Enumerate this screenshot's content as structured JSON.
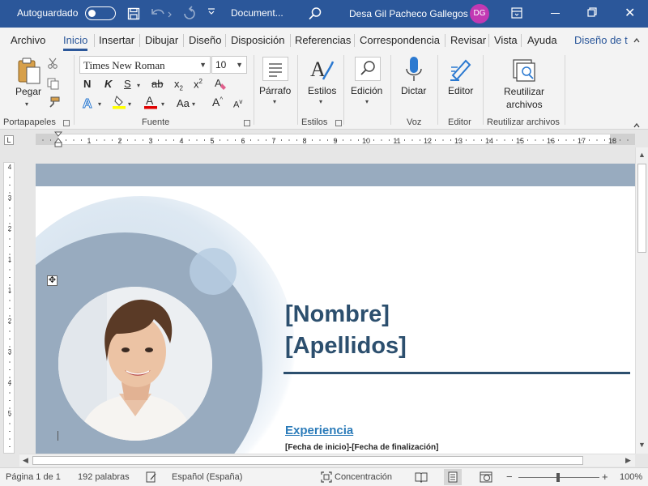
{
  "title_bar": {
    "autosave_label": "Autoguardado",
    "document_name": "Document...",
    "user_name": "Desa Gil Pacheco Gallegos",
    "user_initials": "DG"
  },
  "tabs": [
    "Archivo",
    "Inicio",
    "Insertar",
    "Dibujar",
    "Diseño",
    "Disposición",
    "Referencias",
    "Correspondencia",
    "Revisar",
    "Vista",
    "Ayuda",
    "Diseño de t"
  ],
  "active_tab": "Inicio",
  "ribbon": {
    "clipboard": {
      "paste_label": "Pegar",
      "group_label": "Portapapeles"
    },
    "font": {
      "font_name": "Times New Roman",
      "font_size": "10",
      "bold": "N",
      "italic": "K",
      "underline": "S",
      "strike": "ab",
      "subscript": "x",
      "superscript": "x",
      "change_case": "Aa",
      "grow": "A",
      "shrink": "A",
      "group_label": "Fuente"
    },
    "paragraph": {
      "label": "Párrafo"
    },
    "styles": {
      "label": "Estilos",
      "group_label": "Estilos"
    },
    "editing": {
      "label": "Edición"
    },
    "dictate": {
      "label": "Dictar",
      "group_label": "Voz"
    },
    "editor": {
      "label": "Editor",
      "group_label": "Editor"
    },
    "reuse": {
      "label_line1": "Reutilizar",
      "label_line2": "archivos",
      "group_label": "Reutilizar archivos"
    }
  },
  "document": {
    "first_name": "[Nombre]",
    "last_name": "[Apellidos]",
    "section_heading": "Experiencia",
    "date_range": "[Fecha de inicio]-[Fecha de finalización]"
  },
  "ruler": {
    "h_numbers": [
      "1",
      "2",
      "1",
      "2",
      "3",
      "4",
      "5",
      "6",
      "7",
      "8",
      "9",
      "10",
      "11",
      "12",
      "13",
      "14",
      "15",
      "16",
      "17",
      "18"
    ],
    "v_numbers": [
      "4",
      "3",
      "2",
      "1",
      "1",
      "2",
      "3",
      "4",
      "5"
    ]
  },
  "status_bar": {
    "page": "Página 1 de 1",
    "words": "192 palabras",
    "language": "Español (España)",
    "focus": "Concentración",
    "zoom": "100%",
    "zoom_level": 1.0
  },
  "colors": {
    "titlebar": "#2b579a",
    "accent": "#2b579a",
    "band": "#98abbf",
    "name_text": "#2c4f6e",
    "heading_text": "#2b7bb9",
    "avatar_bg": "#c239b3"
  }
}
